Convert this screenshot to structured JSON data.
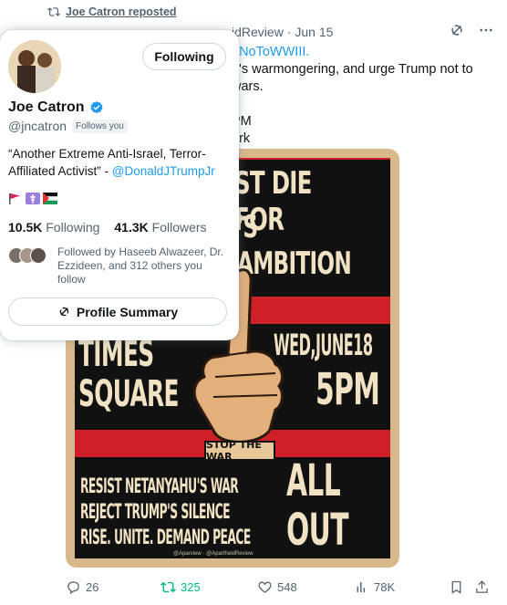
{
  "repost": {
    "user": "Joe Catron reposted",
    "icon": "repost-icon"
  },
  "tweet": {
    "author_fragment": "idReview",
    "date": "· Jun 15",
    "text_lines": [
      "#NoToWWIII.",
      "u's warmongering, and urge Trump not to",
      " wars.",
      "",
      " PM",
      "ork"
    ],
    "poster": {
      "line1": "ST DIE FOR",
      "line2": "'S AMBITION ?",
      "times": "TIMES",
      "square": "SQUARE",
      "date": "WED,JUNE18",
      "time": "5PM",
      "stop": "STOP THE WAR",
      "slogan1": "RESIST NETANYAHU'S WAR",
      "slogan2": "REJECT TRUMP'S SILENCE",
      "slogan3": "RISE. UNITE. DEMAND PEACE",
      "allout1": "ALL",
      "allout2": "OUT !",
      "credit": "@Aparview · @ApartheidReview",
      "colors": {
        "red": "#cf2027",
        "cream": "#f1e2c4",
        "black": "#111111",
        "border": "#d9b98c"
      }
    },
    "actions": {
      "replies": "26",
      "reposts": "325",
      "likes": "548",
      "views": "78K"
    }
  },
  "hovercard": {
    "follow_button": "Following",
    "name": "Joe Catron",
    "handle": "@jncatron",
    "follows_you": "Follows you",
    "bio_text": "“Another Extreme Anti-Israel, Terror-Affiliated Activist” - ",
    "bio_mention": "@DonaldJTrumpJr",
    "following_count": "10.5K",
    "following_label": "Following",
    "followers_count": "41.3K",
    "followers_label": "Followers",
    "followed_by": "Followed by Haseeb Alwazeer, Dr. Ezzideen, and 312 others you follow",
    "profile_summary": "Profile Summary",
    "verified_color": "#1d9bf0"
  }
}
